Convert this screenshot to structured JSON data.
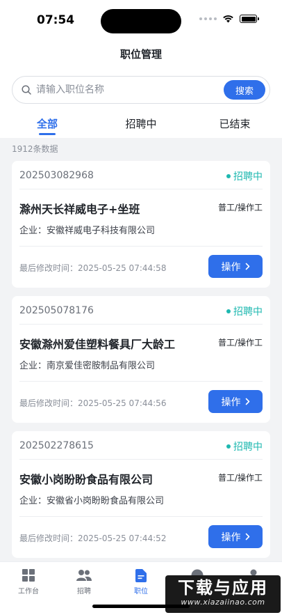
{
  "status_bar": {
    "time": "07:54"
  },
  "nav": {
    "title": "职位管理"
  },
  "search": {
    "placeholder": "请输入职位名称",
    "button_label": "搜索"
  },
  "tabs": [
    {
      "label": "全部",
      "active": true
    },
    {
      "label": "招聘中",
      "active": false
    },
    {
      "label": "已结束",
      "active": false
    }
  ],
  "count_text": "1912条数据",
  "cards": [
    {
      "code": "202503082968",
      "status": "招聘中",
      "title": "滁州天长祥威电子+坐班",
      "type": "普工/操作工",
      "company": "企业：安徽祥威电子科技有限公司",
      "time": "最后修改时间：2025-05-25 07:44:58",
      "button": "操作"
    },
    {
      "code": "202505078176",
      "status": "招聘中",
      "title": "安徽滁州爱佳塑料餐具厂大龄工",
      "type": "普工/操作工",
      "company": "企业：南京爱佳密胺制品有限公司",
      "time": "最后修改时间：2025-05-25 07:44:56",
      "button": "操作"
    },
    {
      "code": "202502278615",
      "status": "招聘中",
      "title": "安徽小岗盼盼食品有限公司",
      "type": "普工/操作工",
      "company": "企业：安徽省小岗盼盼食品有限公司",
      "time": "最后修改时间：2025-05-25 07:44:52",
      "button": "操作"
    }
  ],
  "tabbar": [
    {
      "label": "工作台",
      "icon": "grid-icon"
    },
    {
      "label": "招聘",
      "icon": "users-icon"
    },
    {
      "label": "职位",
      "icon": "document-icon",
      "active": true
    },
    {
      "label": "",
      "icon": "message-icon"
    },
    {
      "label": "",
      "icon": "profile-icon"
    }
  ],
  "watermark": {
    "main": "下载与应用",
    "sub": "www.xiazaiinao.com"
  },
  "colors": {
    "accent": "#2f6fea",
    "status_green": "#1eb8b0"
  }
}
